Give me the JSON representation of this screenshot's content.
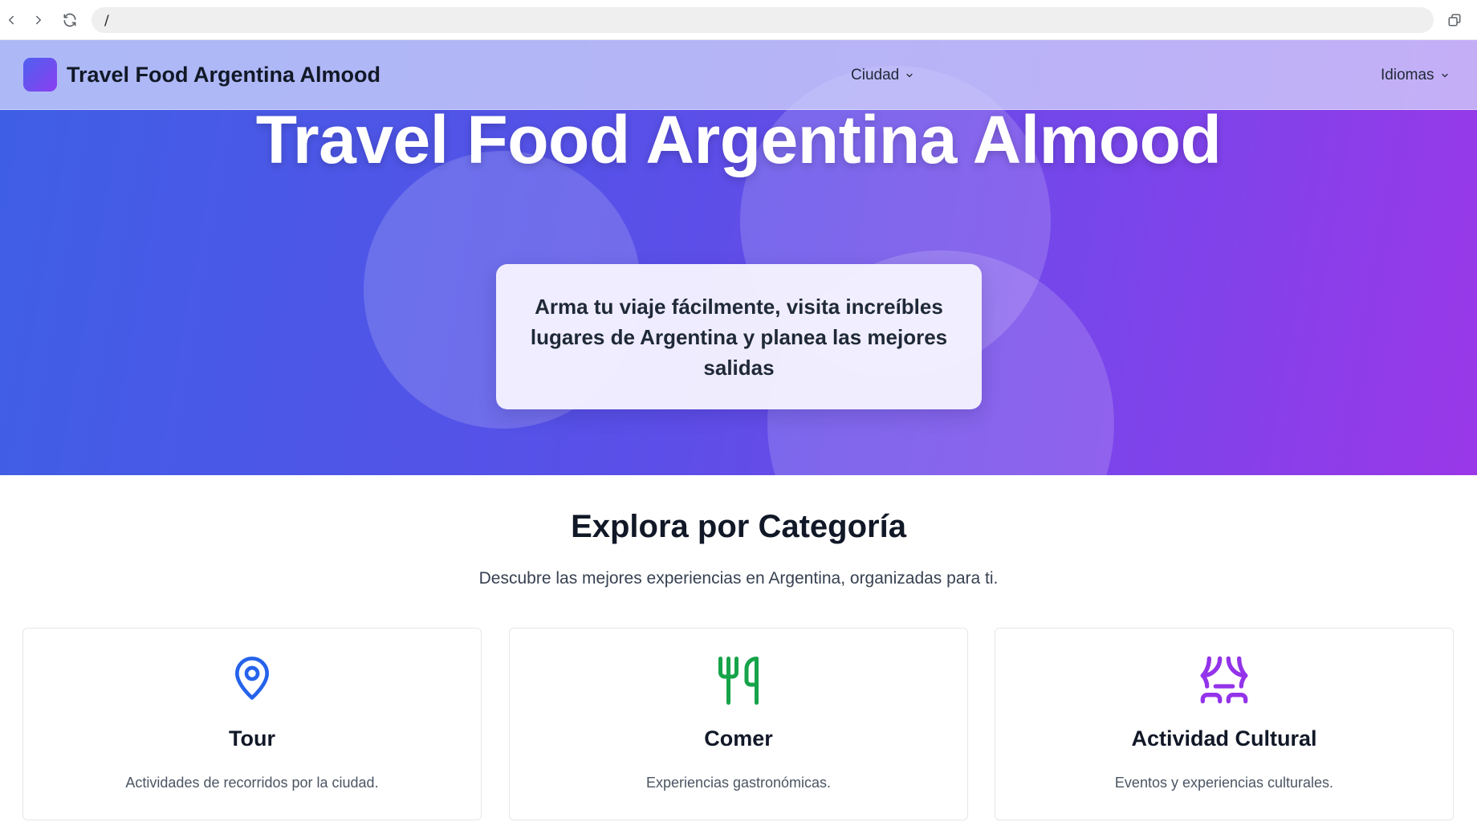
{
  "browser": {
    "url": "/"
  },
  "header": {
    "brand": "Travel Food Argentina Almood",
    "nav": [
      {
        "label": "Ciudad"
      },
      {
        "label": "Idiomas"
      }
    ]
  },
  "hero": {
    "title": "Travel Food Argentina Almood",
    "tagline": "Arma tu viaje fácilmente, visita increíbles lugares de Argentina y planea las mejores salidas"
  },
  "categories": {
    "title": "Explora por Categoría",
    "subtitle": "Descubre las mejores experiencias en Argentina, organizadas para ti.",
    "items": [
      {
        "title": "Tour",
        "description": "Actividades de recorridos por la ciudad.",
        "icon": "map-pin-icon",
        "color": "#2563eb"
      },
      {
        "title": "Comer",
        "description": "Experiencias gastronómicas.",
        "icon": "utensils-icon",
        "color": "#16a34a"
      },
      {
        "title": "Actividad Cultural",
        "description": "Eventos y experiencias culturales.",
        "icon": "theater-icon",
        "color": "#9333ea"
      }
    ]
  },
  "colors": {
    "hero_gradient_start": "#3e5fe6",
    "hero_gradient_end": "#9a38e8",
    "text_primary": "#111827"
  }
}
